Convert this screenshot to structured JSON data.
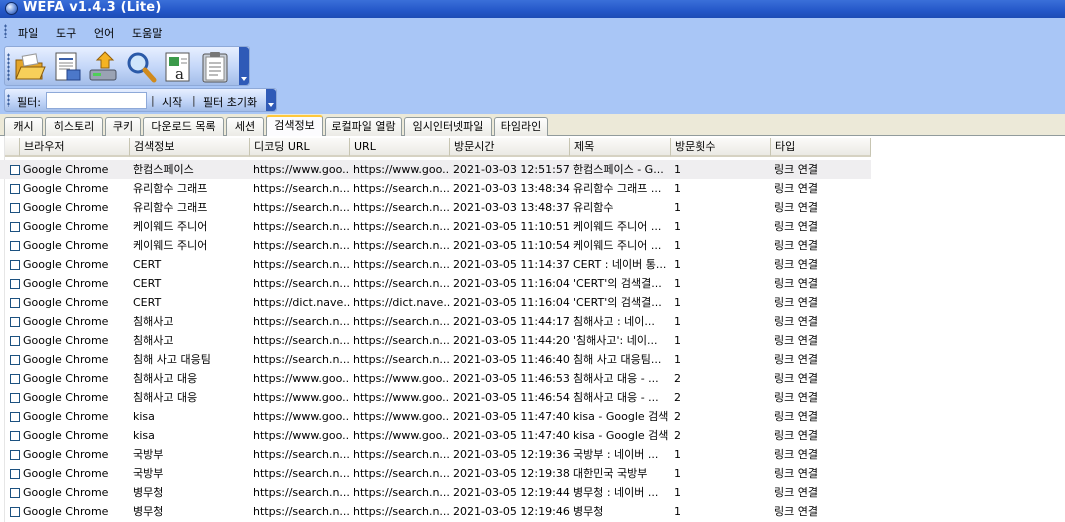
{
  "window": {
    "title": "WEFA v1.4.3 (Lite)"
  },
  "menu": [
    "파일",
    "도구",
    "언어",
    "도움말"
  ],
  "toolbar": {
    "buttons": [
      {
        "icon": "open-folder-icon"
      },
      {
        "icon": "report-icon"
      },
      {
        "icon": "export-icon"
      },
      {
        "icon": "search-icon"
      },
      {
        "icon": "text-viewer-icon"
      },
      {
        "icon": "clipboard-icon"
      }
    ]
  },
  "filter": {
    "label": "필터:",
    "value": "",
    "start": "시작",
    "reset": "필터 초기화"
  },
  "tabs": [
    "캐시",
    "히스토리",
    "쿠키",
    "다운로드 목록",
    "세션",
    "검색정보",
    "로컬파일 열람",
    "임시인터넷파일",
    "타임라인"
  ],
  "active_tab": "검색정보",
  "columns": [
    "브라우저",
    "검색정보",
    "디코딩 URL",
    "URL",
    "방문시간",
    "제목",
    "방문횟수",
    "타입"
  ],
  "rows": [
    [
      "Google Chrome",
      "한컴스페이스",
      "https://www.goo...",
      "https://www.goo...",
      "2021-03-03 12:51:57",
      "한컴스페이스 - G...",
      "1",
      "링크 연결"
    ],
    [
      "Google Chrome",
      "유리함수 그래프",
      "https://search.n...",
      "https://search.n...",
      "2021-03-03 13:48:34",
      "유리함수 그래프 ...",
      "1",
      "링크 연결"
    ],
    [
      "Google Chrome",
      "유리함수 그래프",
      "https://search.n...",
      "https://search.n...",
      "2021-03-03 13:48:37",
      "유리함수",
      "1",
      "링크 연결"
    ],
    [
      "Google Chrome",
      "케이웨드 주니어",
      "https://search.n...",
      "https://search.n...",
      "2021-03-05 11:10:51",
      "케이웨드 주니어 ...",
      "1",
      "링크 연결"
    ],
    [
      "Google Chrome",
      "케이웨드 주니어",
      "https://search.n...",
      "https://search.n...",
      "2021-03-05 11:10:54",
      "케이웨드 주니어 ...",
      "1",
      "링크 연결"
    ],
    [
      "Google Chrome",
      "CERT",
      "https://search.n...",
      "https://search.n...",
      "2021-03-05 11:14:37",
      "CERT : 네이버 통...",
      "1",
      "링크 연결"
    ],
    [
      "Google Chrome",
      "CERT",
      "https://search.n...",
      "https://search.n...",
      "2021-03-05 11:16:04",
      "'CERT'의 검색결...",
      "1",
      "링크 연결"
    ],
    [
      "Google Chrome",
      "CERT",
      "https://dict.nave...",
      "https://dict.nave...",
      "2021-03-05 11:16:04",
      "'CERT'의 검색결...",
      "1",
      "링크 연결"
    ],
    [
      "Google Chrome",
      "침해사고",
      "https://search.n...",
      "https://search.n...",
      "2021-03-05 11:44:17",
      "침해사고 : 네이...",
      "1",
      "링크 연결"
    ],
    [
      "Google Chrome",
      "침해사고",
      "https://search.n...",
      "https://search.n...",
      "2021-03-05 11:44:20",
      "'침해사고': 네이...",
      "1",
      "링크 연결"
    ],
    [
      "Google Chrome",
      "침해 사고 대응팀",
      "https://search.n...",
      "https://search.n...",
      "2021-03-05 11:46:40",
      "침해 사고 대응팀...",
      "1",
      "링크 연결"
    ],
    [
      "Google Chrome",
      "침해사고 대응",
      "https://www.goo...",
      "https://www.goo...",
      "2021-03-05 11:46:53",
      "침해사고 대응 - ...",
      "2",
      "링크 연결"
    ],
    [
      "Google Chrome",
      "침해사고 대응",
      "https://www.goo...",
      "https://www.goo...",
      "2021-03-05 11:46:54",
      "침해사고 대응 - ...",
      "2",
      "링크 연결"
    ],
    [
      "Google Chrome",
      "kisa",
      "https://www.goo...",
      "https://www.goo...",
      "2021-03-05 11:47:40",
      "kisa - Google 검색",
      "2",
      "링크 연결"
    ],
    [
      "Google Chrome",
      "kisa",
      "https://www.goo...",
      "https://www.goo...",
      "2021-03-05 11:47:40",
      "kisa - Google 검색",
      "2",
      "링크 연결"
    ],
    [
      "Google Chrome",
      "국방부",
      "https://search.n...",
      "https://search.n...",
      "2021-03-05 12:19:36",
      "국방부 : 네이버 ...",
      "1",
      "링크 연결"
    ],
    [
      "Google Chrome",
      "국방부",
      "https://search.n...",
      "https://search.n...",
      "2021-03-05 12:19:38",
      "대한민국 국방부",
      "1",
      "링크 연결"
    ],
    [
      "Google Chrome",
      "병무청",
      "https://search.n...",
      "https://search.n...",
      "2021-03-05 12:19:44",
      "병무청 : 네이버 ...",
      "1",
      "링크 연결"
    ],
    [
      "Google Chrome",
      "병무청",
      "https://search.n...",
      "https://search.n...",
      "2021-03-05 12:19:46",
      "병무청",
      "1",
      "링크 연결"
    ]
  ]
}
